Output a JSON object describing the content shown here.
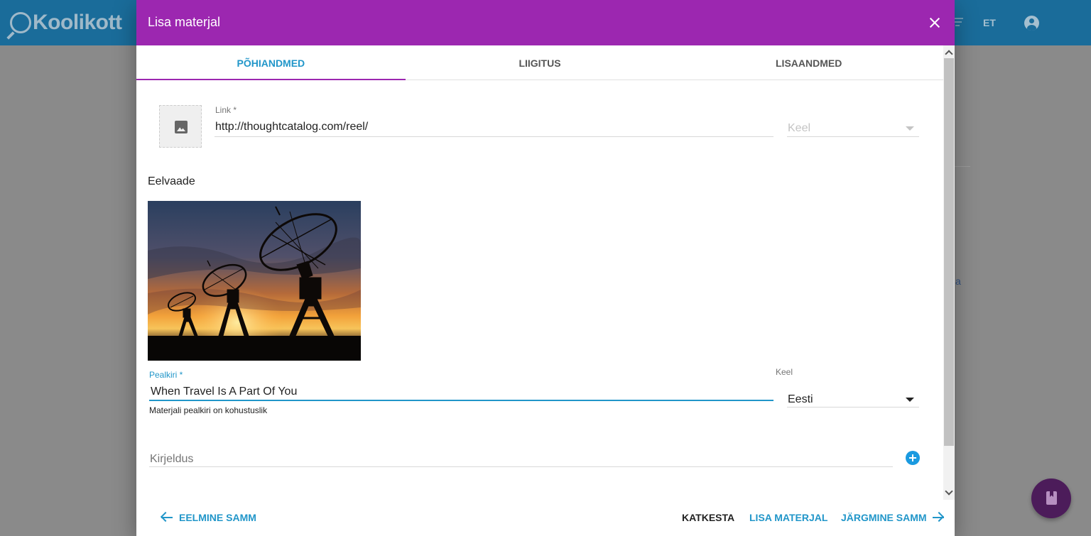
{
  "app": {
    "logo_text": "Koolikott",
    "language": "ET"
  },
  "background": {
    "edge_text": "a"
  },
  "dialog": {
    "title": "Lisa materjal",
    "tabs": [
      {
        "label": "PÕHIANDMED",
        "active": true
      },
      {
        "label": "LIIGITUS",
        "active": false
      },
      {
        "label": "LISAANDMED",
        "active": false
      }
    ]
  },
  "form": {
    "link": {
      "label": "Link *",
      "value": "http://thoughtcatalog.com/reel/"
    },
    "link_language": {
      "placeholder": "Keel"
    },
    "preview": {
      "title": "Eelvaade"
    },
    "title_field": {
      "label": "Pealkiri *",
      "value": "When Travel Is A Part Of You",
      "helper": "Materjali pealkiri on kohustuslik"
    },
    "title_language": {
      "label": "Keel",
      "value": "Eesti"
    },
    "description": {
      "placeholder": "Kirjeldus"
    }
  },
  "footer": {
    "previous": "EELMINE SAMM",
    "cancel": "KATKESTA",
    "add": "LISA MATERJAL",
    "next": "JÄRGMINE SAMM"
  },
  "colors": {
    "accent": "#9c27b0",
    "primary": "#2196c9",
    "app_bar": "#1a6c9a"
  }
}
